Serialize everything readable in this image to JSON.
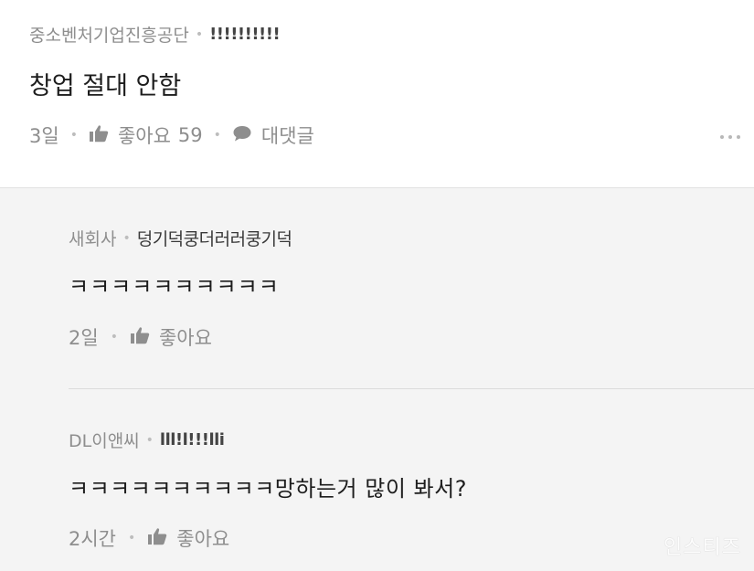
{
  "post": {
    "company": "중소벤처기업진흥공단",
    "nickname": "!!!!!!!!!!",
    "text": "창업 절대 안함",
    "time": "3일",
    "like_label": "좋아요",
    "like_count": "59",
    "reply_label": "대댓글"
  },
  "replies": [
    {
      "company": "새회사",
      "nickname": "덩기덕쿵더러러쿵기덕",
      "text": "ㅋㅋㅋㅋㅋㅋㅋㅋㅋㅋ",
      "time": "2일",
      "like_label": "좋아요"
    },
    {
      "company": "DL이앤씨",
      "nickname": "lll!l!!!lli",
      "text": "ㅋㅋㅋㅋㅋㅋㅋㅋㅋㅋ망하는거 많이 봐서?",
      "time": "2시간",
      "like_label": "좋아요"
    }
  ],
  "watermark": "인스티즈",
  "icons": {
    "like": "thumbs-up-icon",
    "reply": "speech-bubble-icon",
    "more": "more-dots-icon"
  },
  "colors": {
    "meta_gray": "#8e8e8e",
    "body_text": "#1d1d1d",
    "reply_bg": "#f4f4f4"
  }
}
